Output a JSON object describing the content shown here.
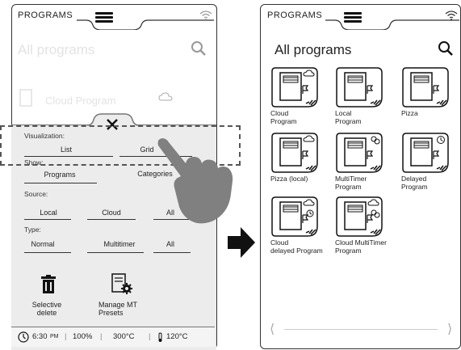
{
  "left_screen": {
    "topbar_label": "PROGRAMS",
    "faded_title": "All programs",
    "faded_item": "Cloud Program",
    "visualization": {
      "label": "Visualization:",
      "options": [
        "List",
        "Grid"
      ]
    },
    "show": {
      "label": "Show:",
      "options": [
        "Programs",
        "Categories"
      ]
    },
    "source": {
      "label": "Source:",
      "options": [
        "Local",
        "Cloud",
        "All"
      ]
    },
    "type": {
      "label": "Type:",
      "options": [
        "Normal",
        "Multitimer",
        "All"
      ]
    },
    "actions": {
      "selective_delete": "Selective delete",
      "manage_presets": "Manage MT Presets"
    },
    "status": {
      "time": "6:30",
      "time_suffix": "PM",
      "percent": "100%",
      "temp1": "300°C",
      "temp2": "120°C"
    }
  },
  "right_screen": {
    "topbar_label": "PROGRAMS",
    "title": "All programs",
    "programs": [
      {
        "label": "Cloud\nProgram",
        "badge": "cloud-icon"
      },
      {
        "label": "Local\nProgram",
        "badge": "none"
      },
      {
        "label": "Pizza",
        "badge": "none"
      },
      {
        "label": "Pizza (local)",
        "badge": "cloud-icon"
      },
      {
        "label": "MultiTimer\nProgram",
        "badge": "multitimer-icon"
      },
      {
        "label": "Delayed\nProgram",
        "badge": "clock-icon"
      },
      {
        "label": "Cloud\ndelayed Program",
        "badge": "cloud-clock-icon"
      },
      {
        "label": "Cloud MultiTimer\nProgram",
        "badge": "cloud-multitimer-icon"
      }
    ]
  }
}
